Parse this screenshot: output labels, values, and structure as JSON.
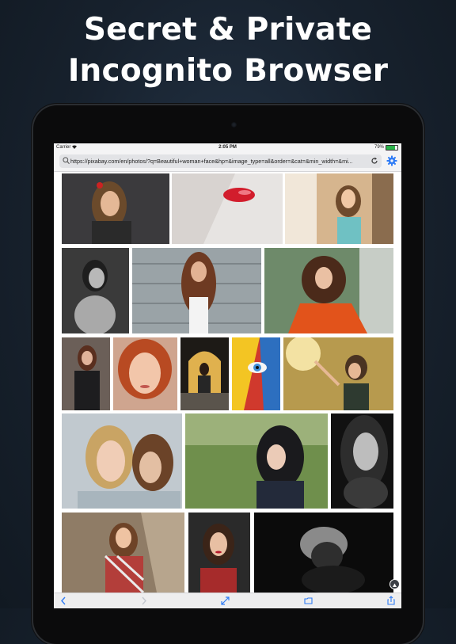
{
  "promo": {
    "headline_line1": "Secret & Private",
    "headline_line2": "Incognito Browser"
  },
  "status_bar": {
    "carrier": "Carrier",
    "time": "2:05 PM",
    "battery": "79%",
    "battery_level": 0.79
  },
  "browser": {
    "url": "https://pixabay.com/en/photos/?q=Beautiful+woman+face&hp=&image_type=all&order=&cat=&min_width=&mi...",
    "accent_color": "#2f7cf6"
  },
  "toolbar": {
    "icons": [
      "back-icon",
      "forward-icon",
      "fullscreen-icon",
      "tabs-icon",
      "share-icon"
    ]
  },
  "gallery": {
    "photos": [
      {
        "icon": "woman-portrait-dark-background"
      },
      {
        "icon": "red-lips-closeup"
      },
      {
        "icon": "woman-city-street"
      },
      {
        "icon": "woman-black-and-white"
      },
      {
        "icon": "woman-boardwalk"
      },
      {
        "icon": "woman-curly-hair-orange-jacket"
      },
      {
        "icon": "woman-leather-jacket"
      },
      {
        "icon": "redhead-woman-portrait"
      },
      {
        "icon": "woman-sitting-archway"
      },
      {
        "icon": "painted-face-art"
      },
      {
        "icon": "woman-reaching-sunlight"
      },
      {
        "icon": "two-women-flower-crown"
      },
      {
        "icon": "woman-dark-hair-park"
      },
      {
        "icon": "woman-black-and-white-closeup"
      },
      {
        "icon": "woman-plaid-shirt"
      },
      {
        "icon": "woman-red-lips-dark"
      },
      {
        "icon": "woman-silhouette-dark"
      }
    ]
  }
}
